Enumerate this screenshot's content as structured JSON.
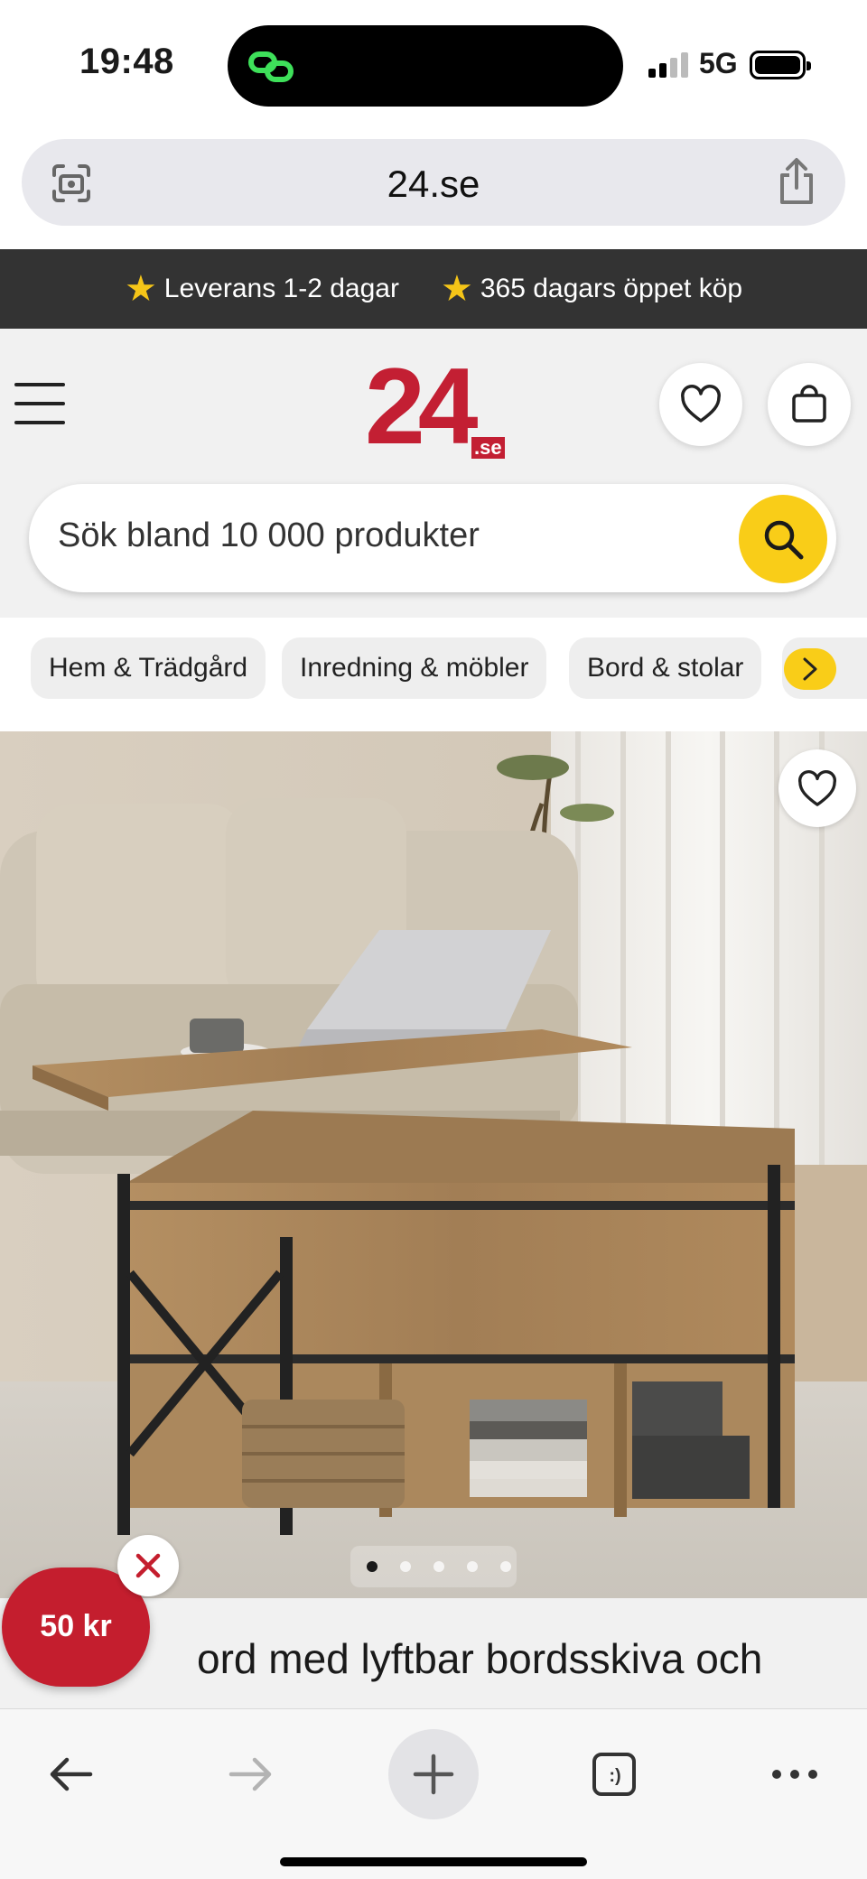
{
  "status_bar": {
    "time": "19:48",
    "network": "5G"
  },
  "browser": {
    "url": "24.se"
  },
  "promo_strip": {
    "items": [
      {
        "icon": "star-icon",
        "text": "Leverans 1-2 dagar"
      },
      {
        "icon": "star-icon",
        "text": "365 dagars öppet köp"
      }
    ]
  },
  "header": {
    "logo_text": "24",
    "logo_suffix": ".se",
    "brand_color": "#c31f33",
    "accent_color": "#f9cd18"
  },
  "search": {
    "placeholder": "Sök bland 10 000 produkter"
  },
  "breadcrumbs": [
    "Hem & Trädgård",
    "Inredning & möbler",
    "Bord & stolar"
  ],
  "gallery": {
    "image_count": 5,
    "active_index": 0
  },
  "product": {
    "title_visible": "ord med lyftbar bordsskiva och"
  },
  "promo_bubble": {
    "label": "50 kr"
  }
}
